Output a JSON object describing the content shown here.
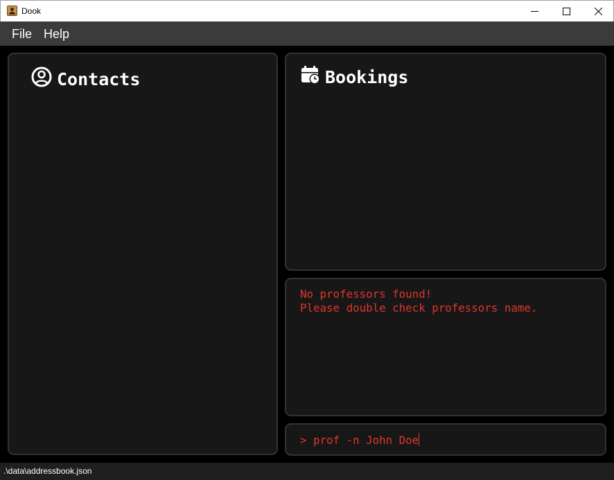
{
  "window": {
    "title": "Dook",
    "app_icon": "contact-book-icon",
    "controls": [
      "minimize-icon",
      "maximize-icon",
      "close-icon"
    ]
  },
  "menubar": {
    "items": [
      {
        "label": "File"
      },
      {
        "label": "Help"
      }
    ]
  },
  "contacts": {
    "title": "Contacts",
    "icon": "user-circle-icon",
    "items": []
  },
  "bookings": {
    "title": "Bookings",
    "icon": "calendar-clock-icon",
    "items": []
  },
  "result": {
    "text": "No professors found!\nPlease double check professors name."
  },
  "command": {
    "value": "> prof -n John Doe"
  },
  "statusbar": {
    "path": ".\\data\\addressbook.json"
  },
  "colors": {
    "background": "#000000",
    "panel": "#171717",
    "panel_border": "#333333",
    "menubar": "#3b3b3b",
    "error_text": "#e0362c",
    "header_text": "#ffffff"
  }
}
